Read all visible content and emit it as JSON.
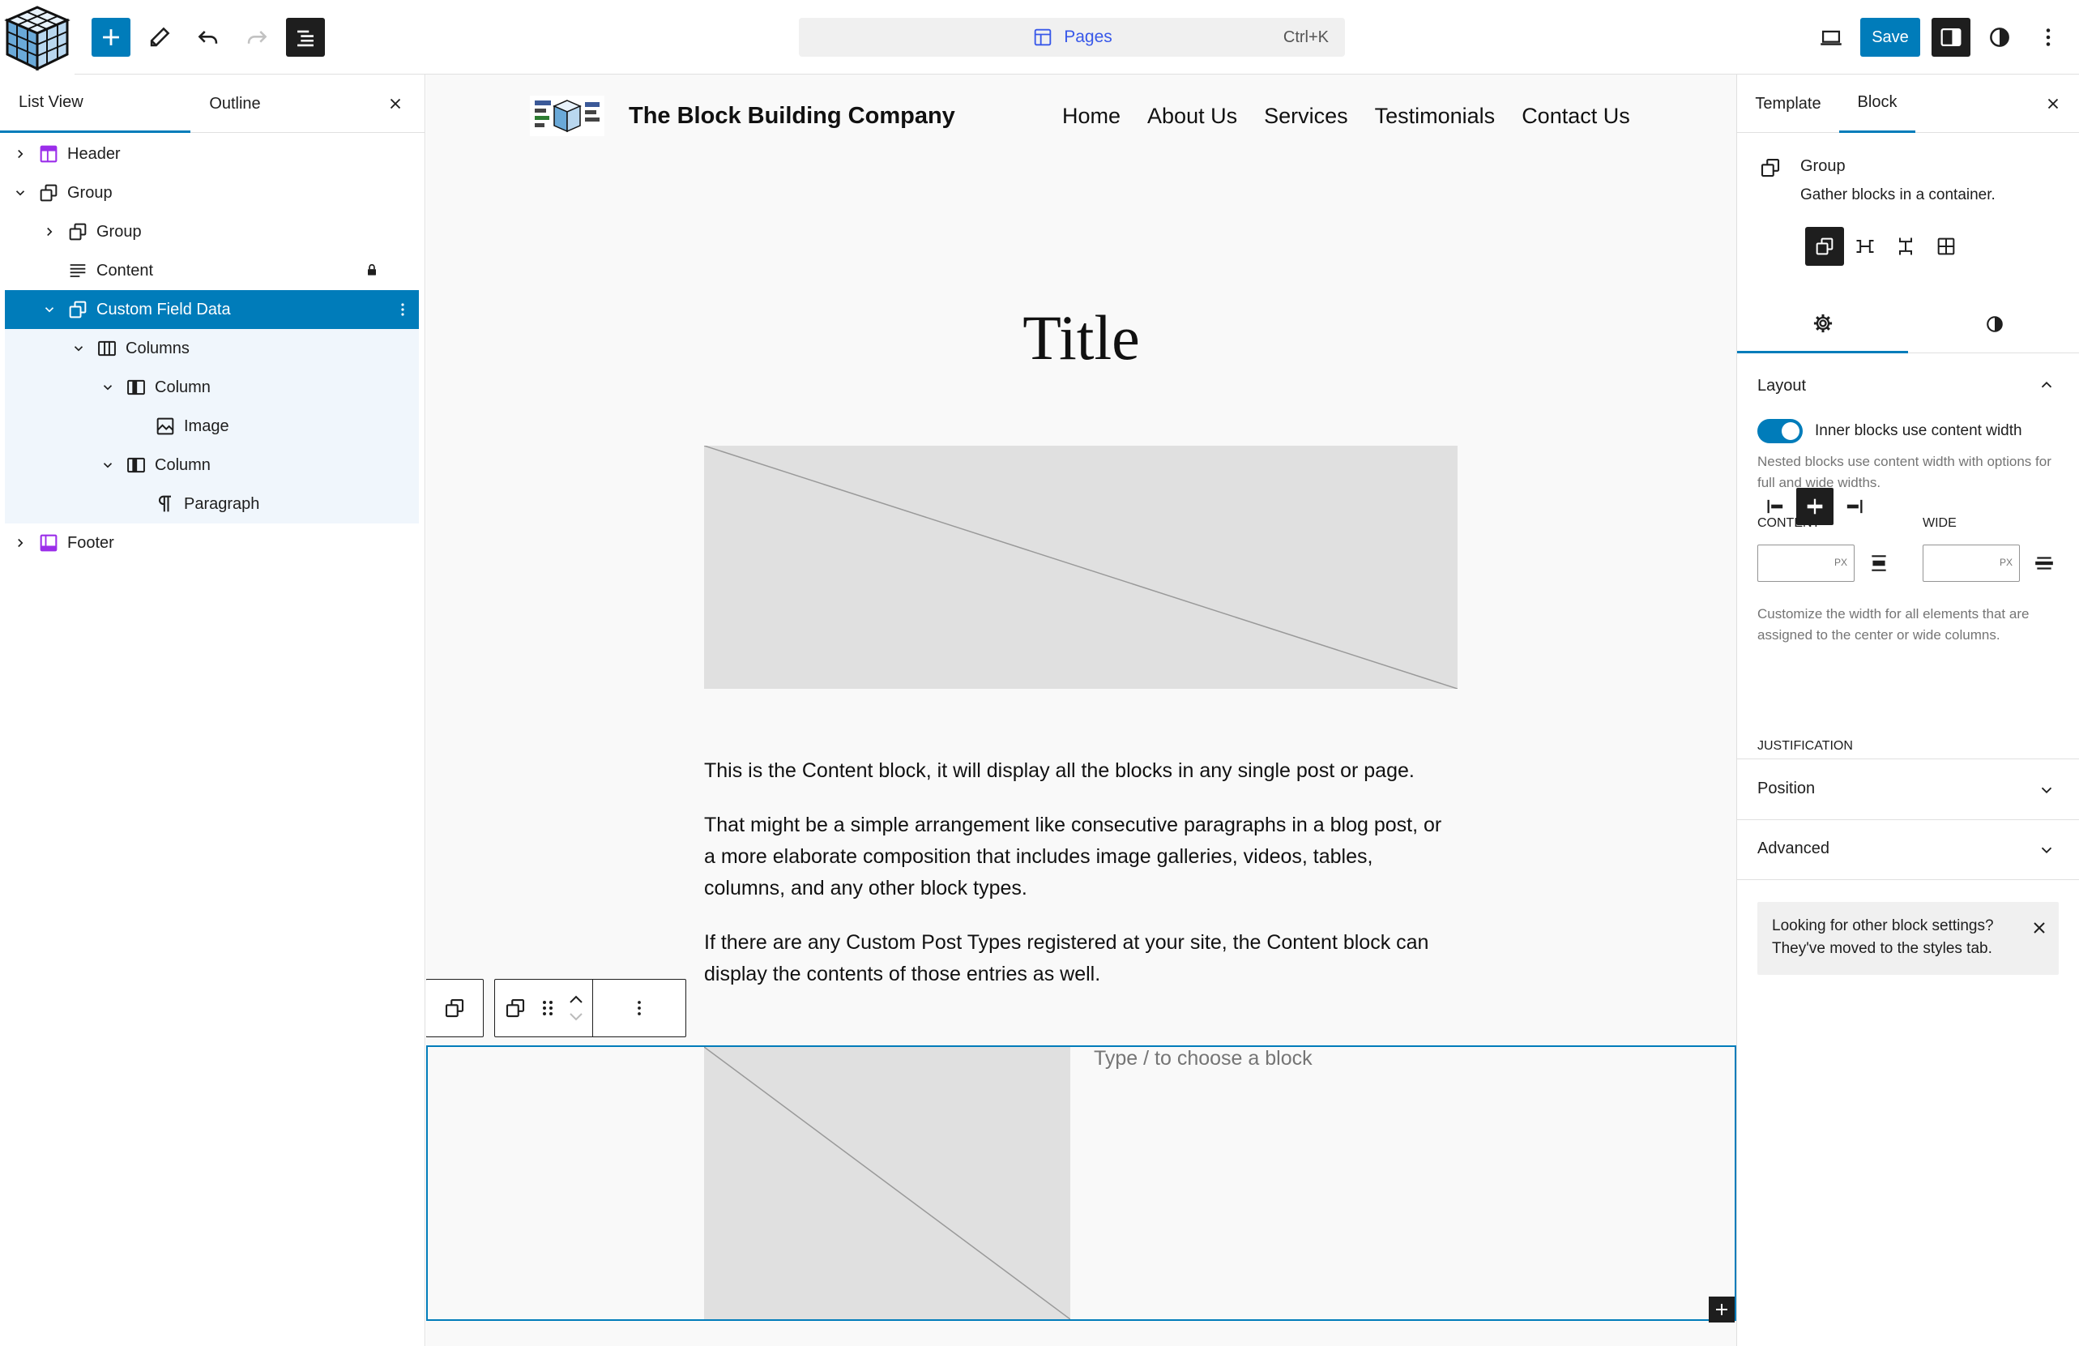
{
  "topbar": {
    "command_label": "Pages",
    "command_shortcut": "Ctrl+K",
    "save_label": "Save"
  },
  "left_panel": {
    "tabs": [
      "List View",
      "Outline"
    ],
    "tree": [
      {
        "label": "Header"
      },
      {
        "label": "Group"
      },
      {
        "label": "Group"
      },
      {
        "label": "Content"
      },
      {
        "label": "Custom Field Data"
      },
      {
        "label": "Columns"
      },
      {
        "label": "Column"
      },
      {
        "label": "Image"
      },
      {
        "label": "Column"
      },
      {
        "label": "Paragraph"
      },
      {
        "label": "Footer"
      }
    ]
  },
  "canvas": {
    "site_title": "The Block Building Company",
    "nav": [
      "Home",
      "About Us",
      "Services",
      "Testimonials",
      "Contact Us"
    ],
    "page_title": "Title",
    "paragraphs": [
      "This is the Content block, it will display all the blocks in any single post or page.",
      "That might be a simple arrangement like consecutive paragraphs in a blog post, or a more elaborate composition that includes image galleries, videos, tables, columns, and any other block types.",
      "If there are any Custom Post Types registered at your site, the Content block can display the contents of those entries as well."
    ],
    "block_placeholder": "Type / to choose a block"
  },
  "right_panel": {
    "tabs": [
      "Template",
      "Block"
    ],
    "block_title": "Group",
    "block_desc": "Gather blocks in a container.",
    "layout": {
      "title": "Layout",
      "toggle_label": "Inner blocks use content width",
      "toggle_help": "Nested blocks use content width with options for full and wide widths.",
      "content_label": "CONTENT",
      "wide_label": "WIDE",
      "unit": "PX",
      "width_help": "Customize the width for all elements that are assigned to the center or wide columns.",
      "justification_label": "JUSTIFICATION"
    },
    "position_title": "Position",
    "advanced_title": "Advanced",
    "notice": "Looking for other block settings? They've moved to the styles tab."
  },
  "colors": {
    "accent": "#007cba",
    "dark": "#1e1e1e",
    "purple": "#9b2eea",
    "placeholder": "#e0e0e0"
  }
}
